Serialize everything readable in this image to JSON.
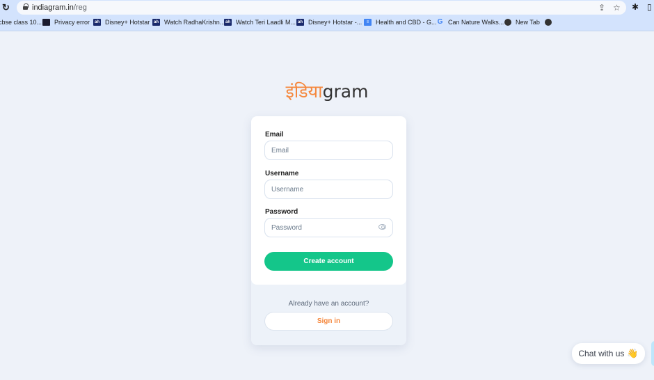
{
  "browser": {
    "url_domain": "indiagram.in",
    "url_path": "/reg",
    "bookmarks": [
      {
        "label": "cbse class 10...",
        "icon": "none"
      },
      {
        "label": "Privacy error",
        "icon": "dark-favicon"
      },
      {
        "label": "Disney+ Hotstar",
        "icon": "hotstar-favicon"
      },
      {
        "label": "Watch RadhaKrishn...",
        "icon": "hotstar-favicon"
      },
      {
        "label": "Watch Teri Laadli M...",
        "icon": "hotstar-favicon"
      },
      {
        "label": "Disney+ Hotstar -...",
        "icon": "hotstar-favicon"
      },
      {
        "label": "Health and CBD - G...",
        "icon": "docs-favicon"
      },
      {
        "label": "Can Nature Walks...",
        "icon": "google-favicon"
      },
      {
        "label": "New Tab",
        "icon": "globe-favicon"
      },
      {
        "label": "",
        "icon": "globe-favicon"
      }
    ],
    "icons": {
      "reload": "↻",
      "share": "⇪",
      "star": "☆",
      "extensions": "✱",
      "sidepanel": "▯"
    }
  },
  "logo": {
    "hindi": "इंडिया",
    "latin": "gram"
  },
  "form": {
    "email_label": "Email",
    "email_placeholder": "Email",
    "username_label": "Username",
    "username_placeholder": "Username",
    "password_label": "Password",
    "password_placeholder": "Password",
    "create_label": "Create account",
    "already_text": "Already have an account?",
    "signin_label": "Sign in"
  },
  "chat": {
    "label": "Chat with us",
    "emoji": "👋"
  },
  "colors": {
    "accent_green": "#14c68a",
    "accent_orange": "#f5873c",
    "page_bg": "#eef2f9"
  }
}
